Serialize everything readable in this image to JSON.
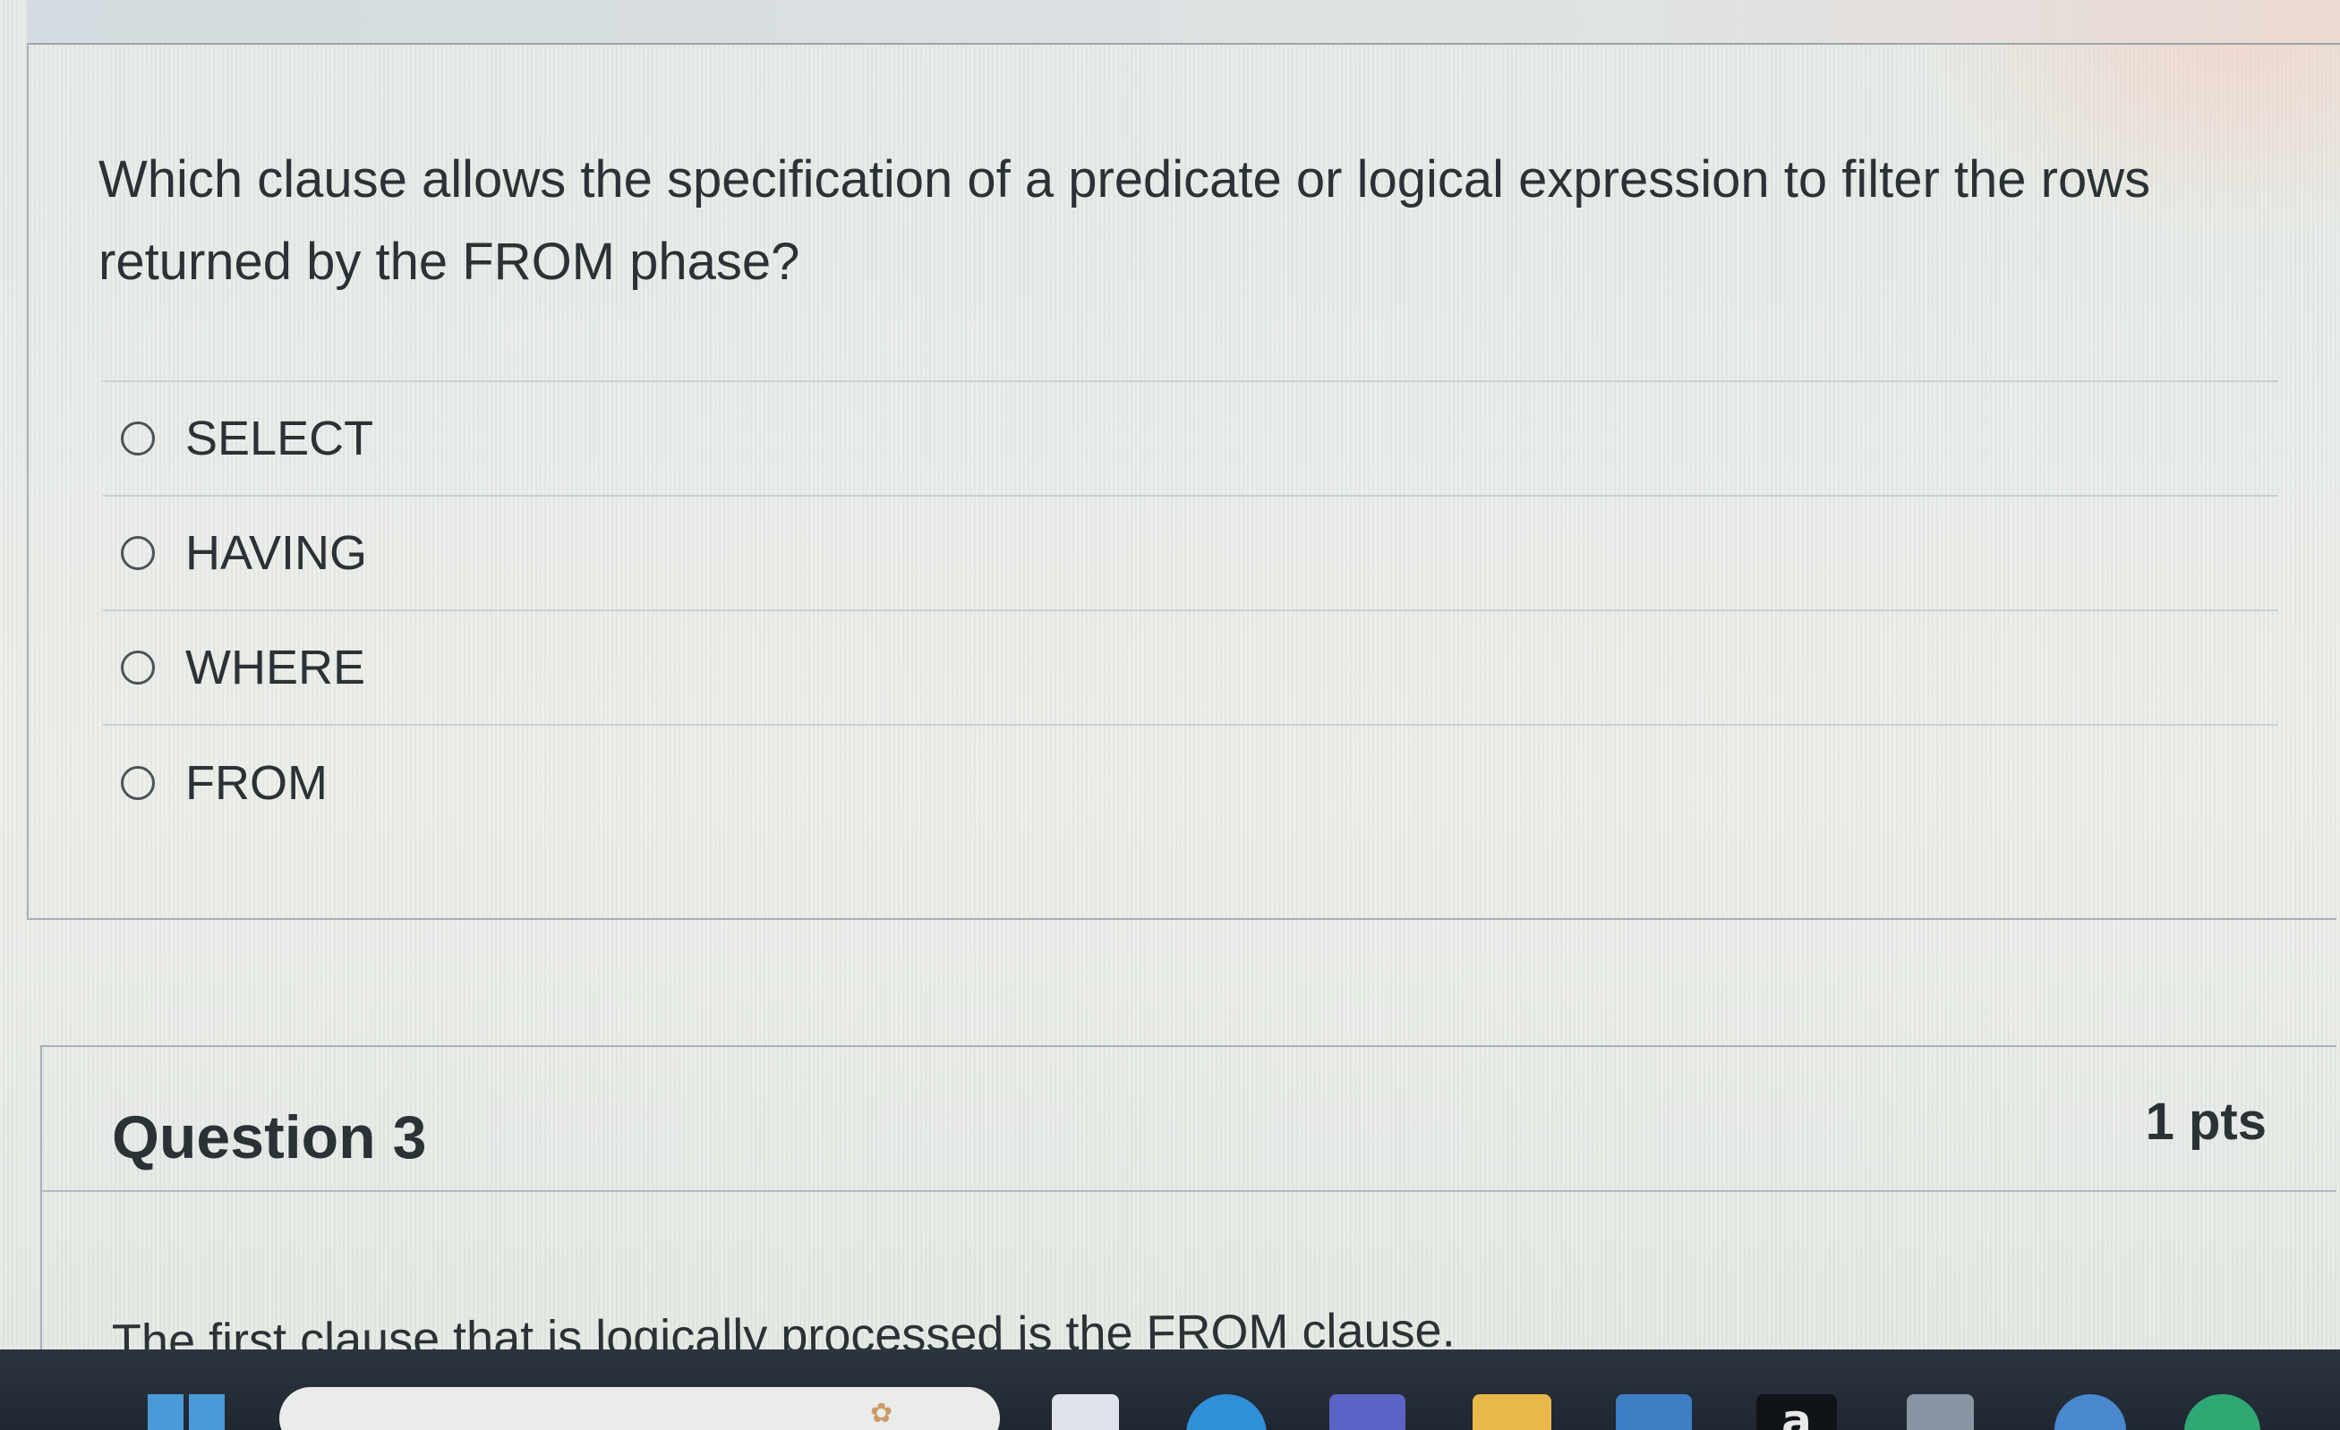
{
  "question": {
    "text_line1": "Which clause allows the specification of a predicate or logical expression to filter the rows",
    "text_line2": "returned by the FROM phase?",
    "answers": [
      {
        "label": "SELECT",
        "selected": false
      },
      {
        "label": "HAVING",
        "selected": false
      },
      {
        "label": "WHERE",
        "selected": false
      },
      {
        "label": "FROM",
        "selected": false
      }
    ]
  },
  "next_question": {
    "title": "Question 3",
    "points": "1 pts",
    "text": "The first clause that is logically processed is the FROM clause."
  },
  "taskbar": {
    "amazon_icon_label": "a",
    "icons": [
      "windows-start-icon",
      "search-box",
      "explorer-icon",
      "edge-icon",
      "teams-icon",
      "folder-icon",
      "store-icon",
      "amazon-icon",
      "calculator-icon",
      "app-icon",
      "chrome-icon"
    ]
  }
}
